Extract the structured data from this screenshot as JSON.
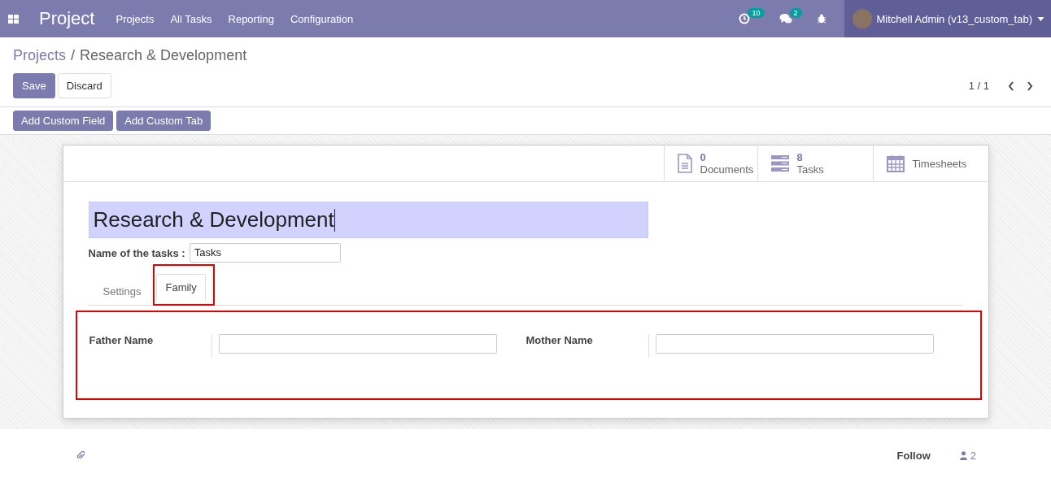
{
  "navbar": {
    "app_name": "Project",
    "menu": [
      "Projects",
      "All Tasks",
      "Reporting",
      "Configuration"
    ],
    "activity_count": "10",
    "message_count": "2",
    "user": "Mitchell Admin (v13_custom_tab)"
  },
  "breadcrumb": {
    "parent": "Projects",
    "separator": "/",
    "current": "Research & Development"
  },
  "actions": [
    "Save",
    "Discard"
  ],
  "pager": {
    "value": "1 / 1"
  },
  "custom_buttons": [
    "Add Custom Field",
    "Add Custom Tab"
  ],
  "smart_buttons": [
    {
      "kind": "documents",
      "count": "0",
      "label": "Documents"
    },
    {
      "kind": "tasks",
      "count": "8",
      "label": "Tasks"
    },
    {
      "kind": "timesheets",
      "label": "Timesheets"
    }
  ],
  "form": {
    "name": "Research & Development",
    "tasks_label": "Name of the tasks :",
    "tasks_value": "Tasks"
  },
  "tabs": [
    {
      "label": "Settings",
      "selected": false,
      "highlighted": false
    },
    {
      "label": "Family",
      "selected": true,
      "highlighted": true
    }
  ],
  "family_panel": {
    "highlighted": true,
    "fields": [
      {
        "label": "Father Name"
      },
      {
        "label": "Mother Name"
      }
    ]
  },
  "chatter": {
    "follow": "Follow",
    "followers": "2"
  }
}
